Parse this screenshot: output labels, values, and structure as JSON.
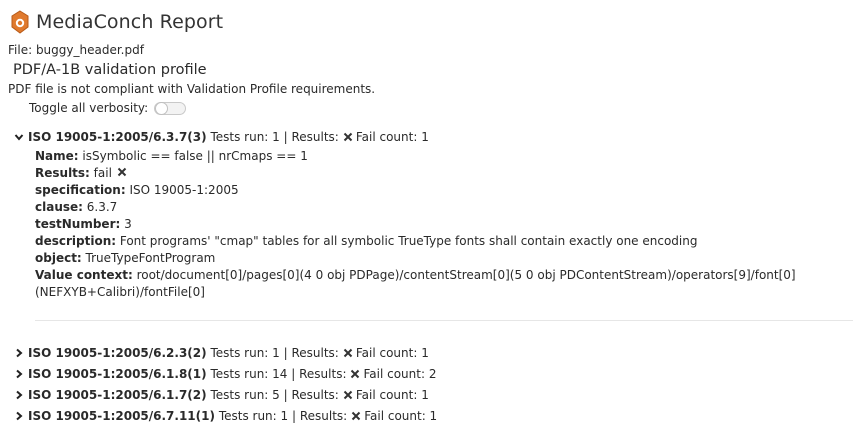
{
  "header": {
    "title": "MediaConch Report"
  },
  "file": "File: buggy_header.pdf",
  "profile": "PDF/A-1B validation profile",
  "status": "PDF file is not compliant with Validation Profile requirements.",
  "toggle_label": "Toggle all verbosity:",
  "tests": [
    {
      "label": "ISO 19005-1:2005/6.3.7(3)",
      "pre": "Tests run: 1 | Results:",
      "post": "Fail count: 1",
      "expanded": true
    },
    {
      "label": "ISO 19005-1:2005/6.2.3(2)",
      "pre": "Tests run: 1 | Results:",
      "post": "Fail count: 1",
      "expanded": false
    },
    {
      "label": "ISO 19005-1:2005/6.1.8(1)",
      "pre": "Tests run: 14 | Results:",
      "post": "Fail count: 2",
      "expanded": false
    },
    {
      "label": "ISO 19005-1:2005/6.1.7(2)",
      "pre": "Tests run: 5 | Results:",
      "post": "Fail count: 1",
      "expanded": false
    },
    {
      "label": "ISO 19005-1:2005/6.7.11(1)",
      "pre": "Tests run: 1 | Results:",
      "post": "Fail count: 1",
      "expanded": false
    }
  ],
  "details": {
    "name_k": "Name:",
    "name_v": " isSymbolic == false || nrCmaps == 1",
    "results_k": "Results:",
    "results_v": " fail",
    "spec_k": "specification:",
    "spec_v": " ISO 19005-1:2005",
    "clause_k": "clause:",
    "clause_v": " 6.3.7",
    "testnum_k": "testNumber:",
    "testnum_v": " 3",
    "desc_k": "description:",
    "desc_v": " Font programs' \"cmap\" tables for all symbolic TrueType fonts shall contain exactly one encoding",
    "object_k": "object:",
    "object_v": " TrueTypeFontProgram",
    "ctx_k": "Value context:",
    "ctx_v": " root/document[0]/pages[0](4 0 obj PDPage)/contentStream[0](5 0 obj PDContentStream)/operators[9]/font[0](NEFXYB+Calibri)/fontFile[0]"
  },
  "colors": {
    "x_mark": "#333333",
    "logo_orange": "#e07a2e"
  }
}
